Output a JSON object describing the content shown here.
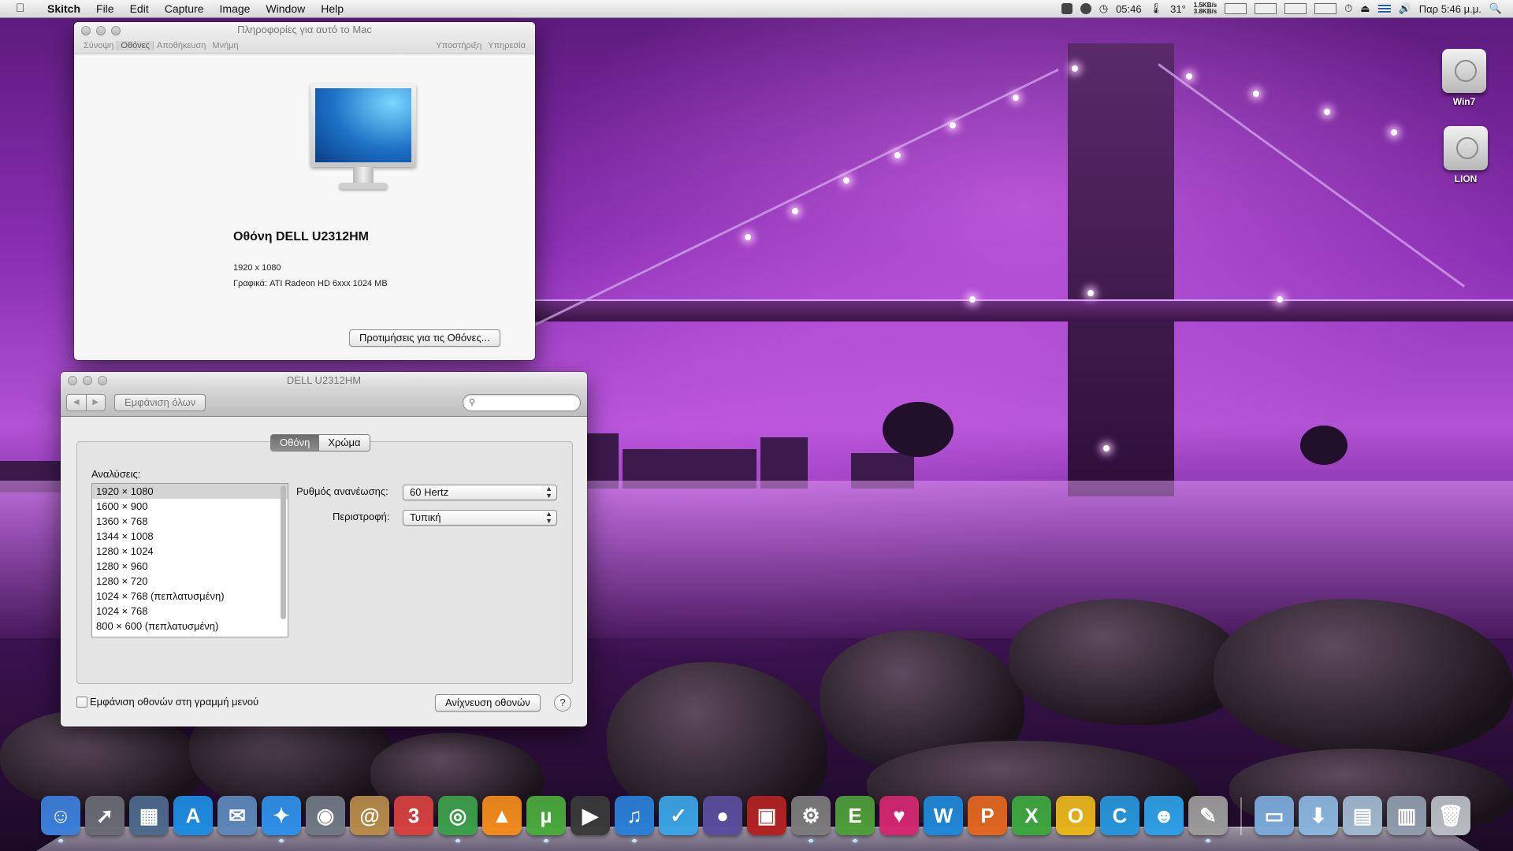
{
  "menubar": {
    "app": "Skitch",
    "menus": [
      "File",
      "Edit",
      "Capture",
      "Image",
      "Window",
      "Help"
    ],
    "time_short": "05:46",
    "temperature": "31°",
    "net_up": "1.5KB/s",
    "net_down": "3.8KB/s",
    "clock": "Παρ 5:46 μ.μ."
  },
  "about": {
    "title": "Πληροφορίες για αυτό το Mac",
    "tabs": [
      "Σύνοψη",
      "Οθόνες",
      "Αποθήκευση",
      "Μνήμη"
    ],
    "right_tabs": [
      "Υποστήριξη",
      "Υπηρεσία"
    ],
    "display_name": "Οθόνη DELL U2312HM",
    "resolution": "1920 x 1080",
    "graphics": "Γραφικά: ATI Radeon HD 6xxx 1024 MB",
    "prefs_button": "Προτιμήσεις για τις Οθόνες..."
  },
  "prefs": {
    "title": "DELL U2312HM",
    "show_all": "Εμφάνιση όλων",
    "search_placeholder": "",
    "segments": [
      "Οθόνη",
      "Χρώμα"
    ],
    "resolutions_label": "Αναλύσεις:",
    "resolutions": [
      "1920 × 1080",
      "1600 × 900",
      "1360 × 768",
      "1344 × 1008",
      "1280 × 1024",
      "1280 × 960",
      "1280 × 720",
      "1024 × 768 (πεπλατυσμένη)",
      "1024 × 768",
      "800 × 600 (πεπλατυσμένη)"
    ],
    "selected_resolution": "1920 × 1080",
    "refresh_label": "Ρυθμός ανανέωσης:",
    "refresh_value": "60 Hertz",
    "rotation_label": "Περιστροφή:",
    "rotation_value": "Τυπική",
    "show_in_menubar": "Εμφάνιση οθονών στη γραμμή μενού",
    "show_in_menubar_checked": false,
    "detect_button": "Ανίχνευση οθονών",
    "help": "?"
  },
  "desktop": {
    "drives": [
      "Win7",
      "LION"
    ]
  },
  "dock": {
    "apps": [
      {
        "icon": "finder-icon",
        "glyph": "☺",
        "color": "#3b7fd9",
        "running": true
      },
      {
        "icon": "launchpad-icon",
        "glyph": "➚",
        "color": "#6a6a74",
        "running": false
      },
      {
        "icon": "mission-control-icon",
        "glyph": "▦",
        "color": "#4d6a8a",
        "running": false
      },
      {
        "icon": "app-store-icon",
        "glyph": "A",
        "color": "#1e8ce0",
        "running": false
      },
      {
        "icon": "mail-icon",
        "glyph": "✉",
        "color": "#5d87b8",
        "running": false
      },
      {
        "icon": "safari-icon",
        "glyph": "✦",
        "color": "#2f8fe6",
        "running": true
      },
      {
        "icon": "facetime-icon",
        "glyph": "◉",
        "color": "#707884",
        "running": false
      },
      {
        "icon": "address-book-icon",
        "glyph": "@",
        "color": "#b58a4a",
        "running": false
      },
      {
        "icon": "calendar-icon",
        "glyph": "3",
        "color": "#d44040",
        "running": false
      },
      {
        "icon": "chrome-icon",
        "glyph": "◎",
        "color": "#3c9e4b",
        "running": true
      },
      {
        "icon": "vlc-icon",
        "glyph": "▲",
        "color": "#f08a1c",
        "running": false
      },
      {
        "icon": "utorrent-icon",
        "glyph": "µ",
        "color": "#4aa83c",
        "running": true
      },
      {
        "icon": "dvd-player-icon",
        "glyph": "▶",
        "color": "#3a3a3a",
        "running": false
      },
      {
        "icon": "itunes-icon",
        "glyph": "♫",
        "color": "#2a7fd6",
        "running": true
      },
      {
        "icon": "twitter-icon",
        "glyph": "✓",
        "color": "#3aa3e3",
        "running": false
      },
      {
        "icon": "network-globe-icon",
        "glyph": "●",
        "color": "#5a4d9c",
        "running": false
      },
      {
        "icon": "photo-booth-icon",
        "glyph": "▣",
        "color": "#b22222",
        "running": false
      },
      {
        "icon": "system-preferences-icon",
        "glyph": "⚙",
        "color": "#7b7b7b",
        "running": true
      },
      {
        "icon": "evernote-icon",
        "glyph": "E",
        "color": "#4e9d3a",
        "running": true
      },
      {
        "icon": "heart-app-icon",
        "glyph": "♥",
        "color": "#d2276f",
        "running": false
      },
      {
        "icon": "word-icon",
        "glyph": "W",
        "color": "#1f86d6",
        "running": false
      },
      {
        "icon": "powerpoint-icon",
        "glyph": "P",
        "color": "#e0661f",
        "running": false
      },
      {
        "icon": "excel-icon",
        "glyph": "X",
        "color": "#3ea63e",
        "running": false
      },
      {
        "icon": "outlook-icon",
        "glyph": "O",
        "color": "#e6b41a",
        "running": false
      },
      {
        "icon": "communicator-icon",
        "glyph": "C",
        "color": "#2794d9",
        "running": false
      },
      {
        "icon": "messenger-icon",
        "glyph": "☻",
        "color": "#2e9ee4",
        "running": false
      },
      {
        "icon": "skitch-icon",
        "glyph": "✎",
        "color": "#9a9a9a",
        "running": true
      }
    ],
    "stacks": [
      {
        "icon": "applications-folder-icon",
        "glyph": "▭",
        "color": "#7aa9d8"
      },
      {
        "icon": "downloads-folder-icon",
        "glyph": "⬇",
        "color": "#8ab4dd"
      },
      {
        "icon": "documents-stack-icon",
        "glyph": "▤",
        "color": "#9fb6cc"
      },
      {
        "icon": "screenshots-stack-icon",
        "glyph": "▥",
        "color": "#8f9bab"
      },
      {
        "icon": "trash-icon",
        "glyph": "🗑",
        "color": "#b8bcc2"
      }
    ]
  }
}
